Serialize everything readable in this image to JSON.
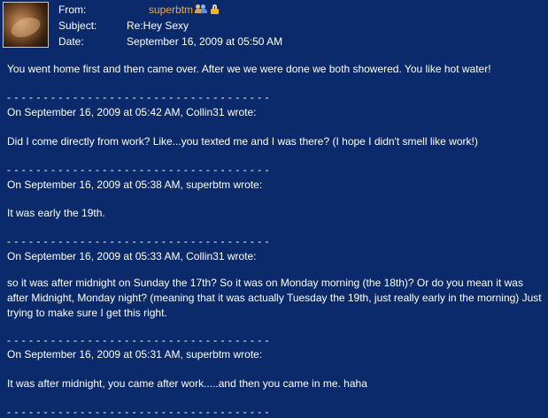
{
  "header": {
    "from_label": "From:",
    "from_value": "superbtm",
    "subject_label": "Subject:",
    "subject_value": "Re:Hey Sexy",
    "date_label": "Date:",
    "date_value": "September 16, 2009 at 05:50 AM"
  },
  "separator": "- - - - - - - - - - - - - - - - - - - - - - - - - - - - - - - - - - - -",
  "messages": [
    {
      "text": "You went home first and then came over. After we we were done we both showered. You like hot water!"
    },
    {
      "attribution": "On September 16, 2009 at 05:42 AM, Collin31 wrote:",
      "text": "Did I come directly from work? Like...you texted me and I was there? (I hope I didn't smell like work!)"
    },
    {
      "attribution": "On September 16, 2009 at 05:38 AM, superbtm wrote:",
      "text": "It was early the 19th."
    },
    {
      "attribution": "On September 16, 2009 at 05:33 AM, Collin31 wrote:",
      "text": "so it was after midnight on Sunday the 17th? So it was on Monday morning (the 18th)? Or do you mean it was after Midnight, Monday night? (meaning that it was actually Tuesday the 19th, just really early in the morning) Just trying to make sure I get this right."
    },
    {
      "attribution": "On September 16, 2009 at 05:31 AM, superbtm wrote:",
      "text": "It was after midnight, you came after work.....and then you came in me. haha"
    }
  ],
  "icons": {
    "friends": "friends-icon",
    "lock": "unlock-icon"
  },
  "colors": {
    "background": "#0b2a6b",
    "sender_name": "#ffa726",
    "text": "#ffffff"
  }
}
